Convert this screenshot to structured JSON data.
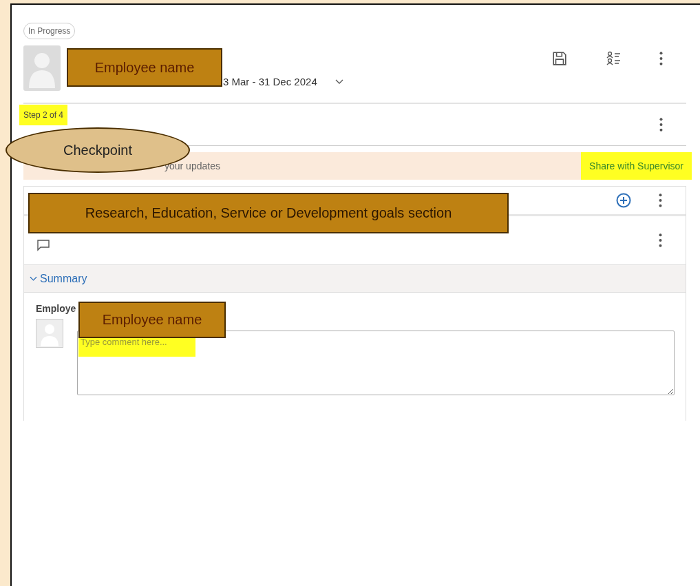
{
  "status_chip": "In Progress",
  "header": {
    "period": "3 Mar - 31 Dec 2024"
  },
  "step": {
    "text": "Step 2 of 4",
    "highlighted": true
  },
  "banner": {
    "message": "your updates",
    "action": "Share with Supervisor",
    "action_highlighted": true
  },
  "goals": {
    "summary": {
      "label": "Summary",
      "expanded": true
    },
    "comment": {
      "author": "Employe",
      "placeholder": "Type comment here...",
      "placeholder_highlighted": true
    }
  },
  "annotations": [
    {
      "kind": "box",
      "text": "Employee name"
    },
    {
      "kind": "ellipse",
      "text": "Checkpoint"
    },
    {
      "kind": "box",
      "text": "Research, Education, Service or Development goals section"
    },
    {
      "kind": "box",
      "text": "Employee name"
    }
  ]
}
